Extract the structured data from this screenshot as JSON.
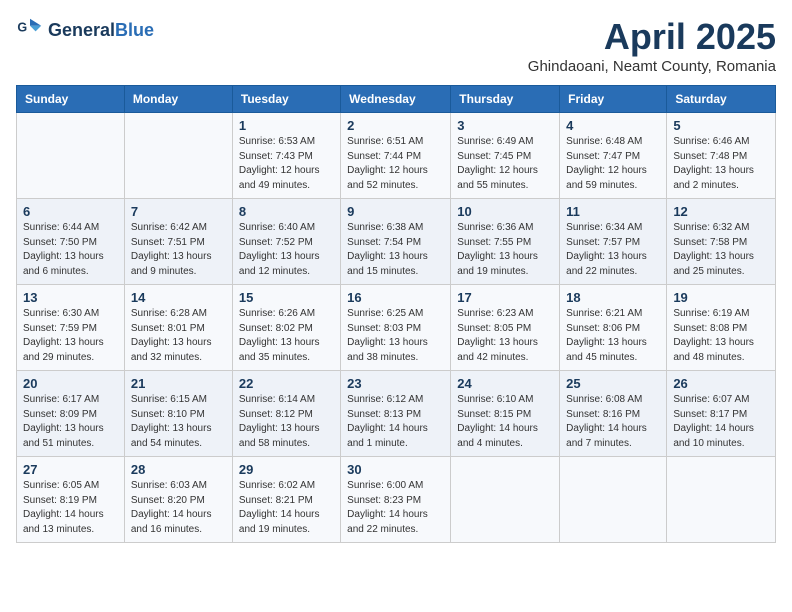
{
  "header": {
    "logo_general": "General",
    "logo_blue": "Blue",
    "title": "April 2025",
    "subtitle": "Ghindaoani, Neamt County, Romania"
  },
  "days_of_week": [
    "Sunday",
    "Monday",
    "Tuesday",
    "Wednesday",
    "Thursday",
    "Friday",
    "Saturday"
  ],
  "weeks": [
    [
      {
        "day": "",
        "info": ""
      },
      {
        "day": "",
        "info": ""
      },
      {
        "day": "1",
        "info": "Sunrise: 6:53 AM\nSunset: 7:43 PM\nDaylight: 12 hours\nand 49 minutes."
      },
      {
        "day": "2",
        "info": "Sunrise: 6:51 AM\nSunset: 7:44 PM\nDaylight: 12 hours\nand 52 minutes."
      },
      {
        "day": "3",
        "info": "Sunrise: 6:49 AM\nSunset: 7:45 PM\nDaylight: 12 hours\nand 55 minutes."
      },
      {
        "day": "4",
        "info": "Sunrise: 6:48 AM\nSunset: 7:47 PM\nDaylight: 12 hours\nand 59 minutes."
      },
      {
        "day": "5",
        "info": "Sunrise: 6:46 AM\nSunset: 7:48 PM\nDaylight: 13 hours\nand 2 minutes."
      }
    ],
    [
      {
        "day": "6",
        "info": "Sunrise: 6:44 AM\nSunset: 7:50 PM\nDaylight: 13 hours\nand 6 minutes."
      },
      {
        "day": "7",
        "info": "Sunrise: 6:42 AM\nSunset: 7:51 PM\nDaylight: 13 hours\nand 9 minutes."
      },
      {
        "day": "8",
        "info": "Sunrise: 6:40 AM\nSunset: 7:52 PM\nDaylight: 13 hours\nand 12 minutes."
      },
      {
        "day": "9",
        "info": "Sunrise: 6:38 AM\nSunset: 7:54 PM\nDaylight: 13 hours\nand 15 minutes."
      },
      {
        "day": "10",
        "info": "Sunrise: 6:36 AM\nSunset: 7:55 PM\nDaylight: 13 hours\nand 19 minutes."
      },
      {
        "day": "11",
        "info": "Sunrise: 6:34 AM\nSunset: 7:57 PM\nDaylight: 13 hours\nand 22 minutes."
      },
      {
        "day": "12",
        "info": "Sunrise: 6:32 AM\nSunset: 7:58 PM\nDaylight: 13 hours\nand 25 minutes."
      }
    ],
    [
      {
        "day": "13",
        "info": "Sunrise: 6:30 AM\nSunset: 7:59 PM\nDaylight: 13 hours\nand 29 minutes."
      },
      {
        "day": "14",
        "info": "Sunrise: 6:28 AM\nSunset: 8:01 PM\nDaylight: 13 hours\nand 32 minutes."
      },
      {
        "day": "15",
        "info": "Sunrise: 6:26 AM\nSunset: 8:02 PM\nDaylight: 13 hours\nand 35 minutes."
      },
      {
        "day": "16",
        "info": "Sunrise: 6:25 AM\nSunset: 8:03 PM\nDaylight: 13 hours\nand 38 minutes."
      },
      {
        "day": "17",
        "info": "Sunrise: 6:23 AM\nSunset: 8:05 PM\nDaylight: 13 hours\nand 42 minutes."
      },
      {
        "day": "18",
        "info": "Sunrise: 6:21 AM\nSunset: 8:06 PM\nDaylight: 13 hours\nand 45 minutes."
      },
      {
        "day": "19",
        "info": "Sunrise: 6:19 AM\nSunset: 8:08 PM\nDaylight: 13 hours\nand 48 minutes."
      }
    ],
    [
      {
        "day": "20",
        "info": "Sunrise: 6:17 AM\nSunset: 8:09 PM\nDaylight: 13 hours\nand 51 minutes."
      },
      {
        "day": "21",
        "info": "Sunrise: 6:15 AM\nSunset: 8:10 PM\nDaylight: 13 hours\nand 54 minutes."
      },
      {
        "day": "22",
        "info": "Sunrise: 6:14 AM\nSunset: 8:12 PM\nDaylight: 13 hours\nand 58 minutes."
      },
      {
        "day": "23",
        "info": "Sunrise: 6:12 AM\nSunset: 8:13 PM\nDaylight: 14 hours\nand 1 minute."
      },
      {
        "day": "24",
        "info": "Sunrise: 6:10 AM\nSunset: 8:15 PM\nDaylight: 14 hours\nand 4 minutes."
      },
      {
        "day": "25",
        "info": "Sunrise: 6:08 AM\nSunset: 8:16 PM\nDaylight: 14 hours\nand 7 minutes."
      },
      {
        "day": "26",
        "info": "Sunrise: 6:07 AM\nSunset: 8:17 PM\nDaylight: 14 hours\nand 10 minutes."
      }
    ],
    [
      {
        "day": "27",
        "info": "Sunrise: 6:05 AM\nSunset: 8:19 PM\nDaylight: 14 hours\nand 13 minutes."
      },
      {
        "day": "28",
        "info": "Sunrise: 6:03 AM\nSunset: 8:20 PM\nDaylight: 14 hours\nand 16 minutes."
      },
      {
        "day": "29",
        "info": "Sunrise: 6:02 AM\nSunset: 8:21 PM\nDaylight: 14 hours\nand 19 minutes."
      },
      {
        "day": "30",
        "info": "Sunrise: 6:00 AM\nSunset: 8:23 PM\nDaylight: 14 hours\nand 22 minutes."
      },
      {
        "day": "",
        "info": ""
      },
      {
        "day": "",
        "info": ""
      },
      {
        "day": "",
        "info": ""
      }
    ]
  ]
}
